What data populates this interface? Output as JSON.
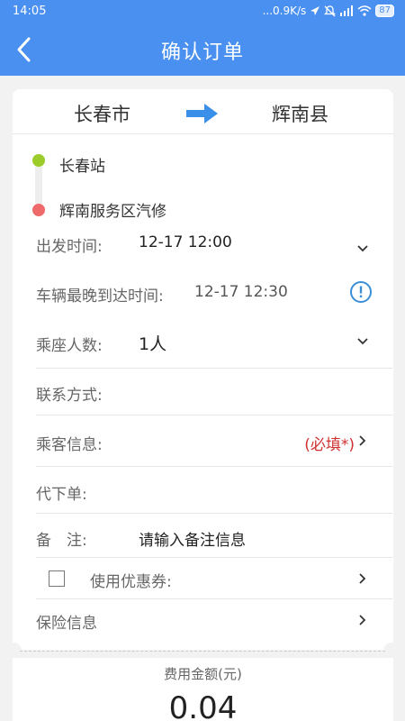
{
  "status_bar": {
    "time": "14:05",
    "network_speed": "...0.9K/s",
    "battery": "87"
  },
  "header": {
    "title": "确认订单"
  },
  "route": {
    "from_city": "长春市",
    "to_city": "辉南县"
  },
  "stops": {
    "start": "长春站",
    "end": "辉南服务区汽修"
  },
  "form": {
    "departure_label": "出发时间:",
    "departure_value": "12-17 12:00",
    "latest_arrival_label": "车辆最晚到达时间:",
    "latest_arrival_value": "12-17 12:30",
    "seats_label": "乘座人数:",
    "seats_value": "1人",
    "contact_label": "联系方式:",
    "passenger_label": "乘客信息:",
    "passenger_required": "(必填*)",
    "proxy_label": "代下单:",
    "remark_label": "备　注:",
    "remark_placeholder": "请输入备注信息",
    "coupon_label": "使用优惠券:",
    "insurance_label": "保险信息"
  },
  "fee": {
    "label": "费用金额(元)",
    "amount": "0.04"
  },
  "colors": {
    "brand": "#4a90f0",
    "start_dot": "#9ccc2a",
    "end_dot": "#ef6b6b",
    "required": "#d03030",
    "info_icon": "#3a8fd8"
  }
}
